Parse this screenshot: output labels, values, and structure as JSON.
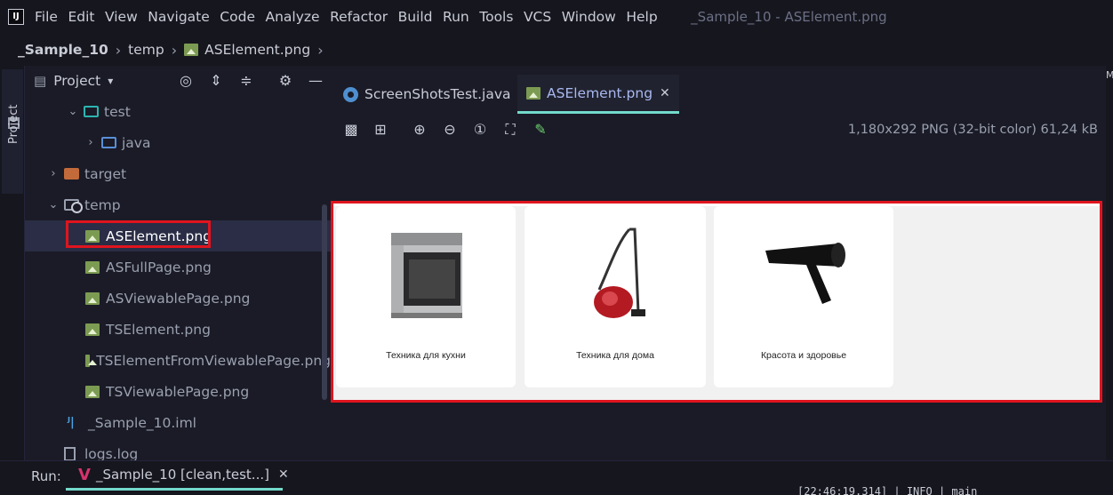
{
  "menubar": {
    "logo": "IJ",
    "items": [
      "File",
      "Edit",
      "View",
      "Navigate",
      "Code",
      "Analyze",
      "Refactor",
      "Build",
      "Run",
      "Tools",
      "VCS",
      "Window",
      "Help"
    ],
    "window_title": "_Sample_10 - ASElement.png"
  },
  "breadcrumb": {
    "project": "_Sample_10",
    "folder": "temp",
    "file": "ASElement.png"
  },
  "left_stripe": {
    "label": "Project"
  },
  "project_panel": {
    "title": "Project",
    "tree": [
      {
        "label": "test",
        "type": "folder-test",
        "expanded": true,
        "indent": 1
      },
      {
        "label": "java",
        "type": "folder-source",
        "expanded": false,
        "indent": 2
      },
      {
        "label": "target",
        "type": "folder-excluded",
        "expanded": false,
        "indent": 0
      },
      {
        "label": "temp",
        "type": "folder-temp",
        "expanded": true,
        "indent": 0
      },
      {
        "label": "ASElement.png",
        "type": "image",
        "selected": true,
        "indent": 1
      },
      {
        "label": "ASFullPage.png",
        "type": "image",
        "indent": 1
      },
      {
        "label": "ASViewablePage.png",
        "type": "image",
        "indent": 1
      },
      {
        "label": "TSElement.png",
        "type": "image",
        "indent": 1
      },
      {
        "label": "TSElementFromViewablePage.png",
        "type": "image",
        "indent": 1
      },
      {
        "label": "TSViewablePage.png",
        "type": "image",
        "indent": 1
      },
      {
        "label": "_Sample_10.iml",
        "type": "iml",
        "indent": 0
      },
      {
        "label": "logs.log",
        "type": "log",
        "indent": 0
      }
    ]
  },
  "editor": {
    "tabs": [
      {
        "label": "ScreenShotsTest.java",
        "active": false
      },
      {
        "label": "ASElement.png",
        "active": true
      }
    ],
    "image_info": "1,180x292 PNG (32-bit color) 61,24 kB",
    "image_cards": [
      {
        "label": "Техника для кухни",
        "picture": "stove"
      },
      {
        "label": "Техника для дома",
        "picture": "vacuum-cleaner"
      },
      {
        "label": "Красота и здоровье",
        "picture": "hair-dryer"
      }
    ]
  },
  "right_stripe": {
    "label": "M"
  },
  "runbar": {
    "label": "Run:",
    "tab_label": "_Sample_10 [clean,test...]",
    "log_text": "[22:46:19.314] | INFO  | main"
  },
  "colors": {
    "highlight_border": "#e0141e",
    "active_tab_underline": "#73daca",
    "background": "#1a1b26"
  }
}
